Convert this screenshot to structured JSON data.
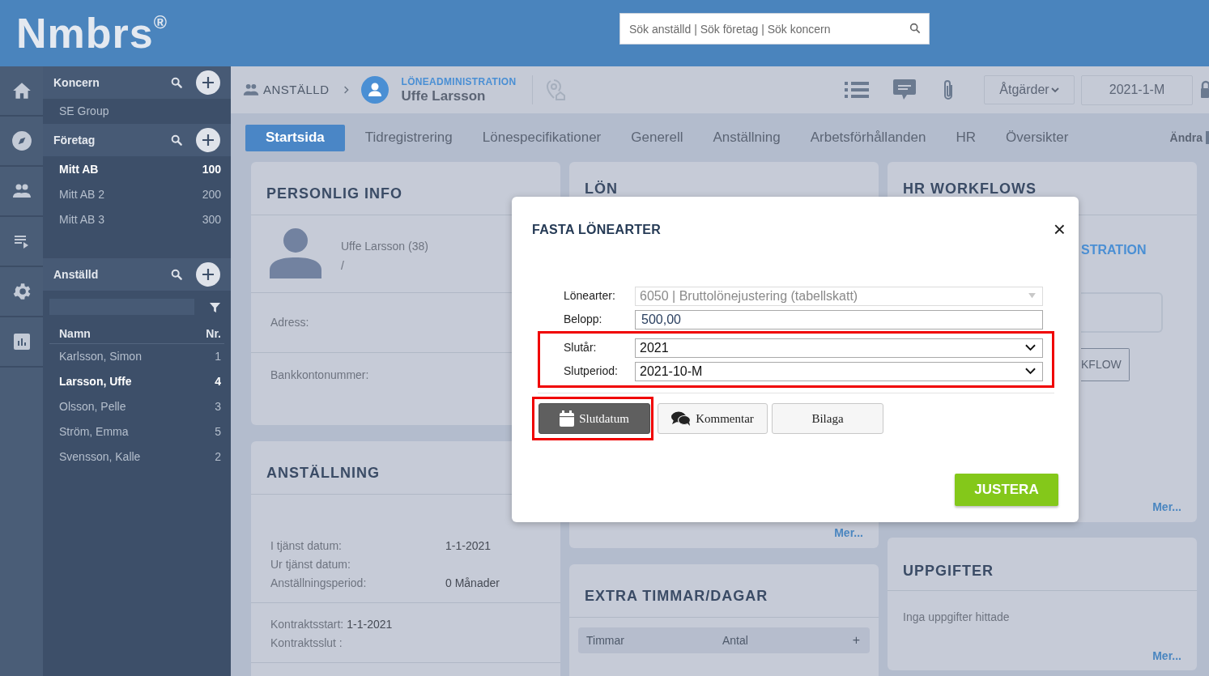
{
  "header": {
    "logo": "Nmbrs",
    "logo_mark": "®",
    "search": {
      "placeholder": "Sök anställd | Sök företag | Sök koncern"
    }
  },
  "sidebar": {
    "sections": [
      {
        "title": "Koncern",
        "items": [
          {
            "name": "SE Group",
            "selected": false
          }
        ]
      },
      {
        "title": "Företag",
        "items": [
          {
            "name": "Mitt AB",
            "number": "100",
            "selected": true
          },
          {
            "name": "Mitt AB 2",
            "number": "200",
            "selected": false
          },
          {
            "name": "Mitt AB 3",
            "number": "300",
            "selected": false
          }
        ]
      }
    ],
    "employees": {
      "title": "Anställd",
      "columns": [
        "Namn",
        "Nr."
      ],
      "rows": [
        {
          "name": "Karlsson, Simon",
          "number": "1",
          "selected": false
        },
        {
          "name": "Larsson, Uffe",
          "number": "4",
          "selected": true
        },
        {
          "name": "Olsson, Pelle",
          "number": "3",
          "selected": false
        },
        {
          "name": "Ström, Emma",
          "number": "5",
          "selected": false
        },
        {
          "name": "Svensson, Kalle",
          "number": "2",
          "selected": false
        }
      ]
    }
  },
  "breadcrumb": {
    "section": "ANSTÄLLD",
    "module": "LÖNEADMINISTRATION",
    "employee": "Uffe Larsson"
  },
  "toolbar": {
    "actions": "Åtgärder",
    "period": "2021-1-M"
  },
  "tabs": [
    {
      "label": "Startsida",
      "selected": true
    },
    {
      "label": "Tidregistrering",
      "selected": false
    },
    {
      "label": "Lönespecifikationer",
      "selected": false
    },
    {
      "label": "Generell",
      "selected": false
    },
    {
      "label": "Anställning",
      "selected": false
    },
    {
      "label": "Arbetsförhållanden",
      "selected": false
    },
    {
      "label": "HR",
      "selected": false
    },
    {
      "label": "Översikter",
      "selected": false
    }
  ],
  "edit_link": "Ändra",
  "personal_info": {
    "title": "PERSONLIG INFO",
    "name": "Uffe Larsson (38)",
    "subline": "/",
    "fields": [
      "Adress:",
      "Bankkontonummer:"
    ]
  },
  "employment": {
    "title": "ANSTÄLLNING",
    "rows": [
      {
        "label": "I tjänst datum:",
        "value": "1-1-2021"
      },
      {
        "label": "Ur tjänst datum:"
      },
      {
        "label": "Anställningsperiod:",
        "value": "0 Månader"
      }
    ],
    "contract": [
      {
        "label": "Kontraktsstart:",
        "value": "1-1-2021"
      },
      {
        "label": "Kontraktsslut :"
      }
    ]
  },
  "salary": {
    "title": "LÖN",
    "more": "Mer..."
  },
  "hr_workflows": {
    "title": "HR WORKFLOWS",
    "module": "STRATION",
    "button": "KFLOW",
    "more": "Mer..."
  },
  "extra": {
    "title": "EXTRA TIMMAR/DAGAR",
    "columns": [
      "Timmar",
      "Antal"
    ],
    "add": "+"
  },
  "tasks": {
    "title": "UPPGIFTER",
    "empty": "Inga uppgifter hittade",
    "more": "Mer..."
  },
  "modal": {
    "title": "FASTA LÖNEARTER",
    "close": "×",
    "fields": [
      {
        "label": "Lönearter:",
        "value": "6050 | Bruttolönejustering (tabellskatt)",
        "kind": "select",
        "disabled": true,
        "highlighted": false
      },
      {
        "label": "Belopp:",
        "value": "500,00",
        "kind": "input",
        "disabled": false,
        "highlighted": false
      },
      {
        "label": "Slutår:",
        "value": "2021",
        "kind": "select",
        "disabled": false,
        "highlighted": true
      },
      {
        "label": "Slutperiod:",
        "value": "2021-10-M",
        "kind": "select",
        "disabled": false,
        "highlighted": true
      }
    ],
    "buttons": [
      {
        "label": "Slutdatum",
        "active": true,
        "highlighted": true
      },
      {
        "label": "Kommentar",
        "active": false,
        "highlighted": false
      },
      {
        "label": "Bilaga",
        "active": false,
        "highlighted": false
      }
    ],
    "submit": "JUSTERA"
  }
}
